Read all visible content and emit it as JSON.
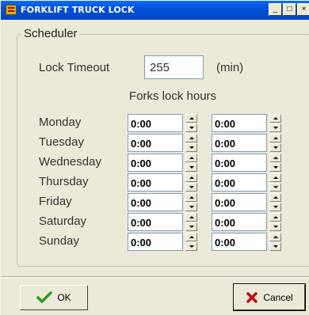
{
  "window": {
    "title": "FORKLIFT TRUCK LOCK",
    "minimize": "_",
    "maximize": "□",
    "close": "×"
  },
  "scheduler": {
    "group_label": "Scheduler",
    "lock_timeout_label": "Lock Timeout",
    "lock_timeout_value": "255",
    "lock_timeout_unit": "(min)",
    "forks_lock_hours_label": "Forks lock hours",
    "days": [
      {
        "name": "Monday",
        "from": "0:00",
        "to": "0:00"
      },
      {
        "name": "Tuesday",
        "from": "0:00",
        "to": "0:00"
      },
      {
        "name": "Wednesday",
        "from": "0:00",
        "to": "0:00"
      },
      {
        "name": "Thursday",
        "from": "0:00",
        "to": "0:00"
      },
      {
        "name": "Friday",
        "from": "0:00",
        "to": "0:00"
      },
      {
        "name": "Saturday",
        "from": "0:00",
        "to": "0:00"
      },
      {
        "name": "Sunday",
        "from": "0:00",
        "to": "0:00"
      }
    ]
  },
  "buttons": {
    "ok": "OK",
    "cancel": "Cancel"
  },
  "colors": {
    "title_bar": "#0250d6",
    "window_bg": "#ece9d8",
    "ok_check": "#2e9b1f",
    "cancel_cross": "#c01010"
  }
}
